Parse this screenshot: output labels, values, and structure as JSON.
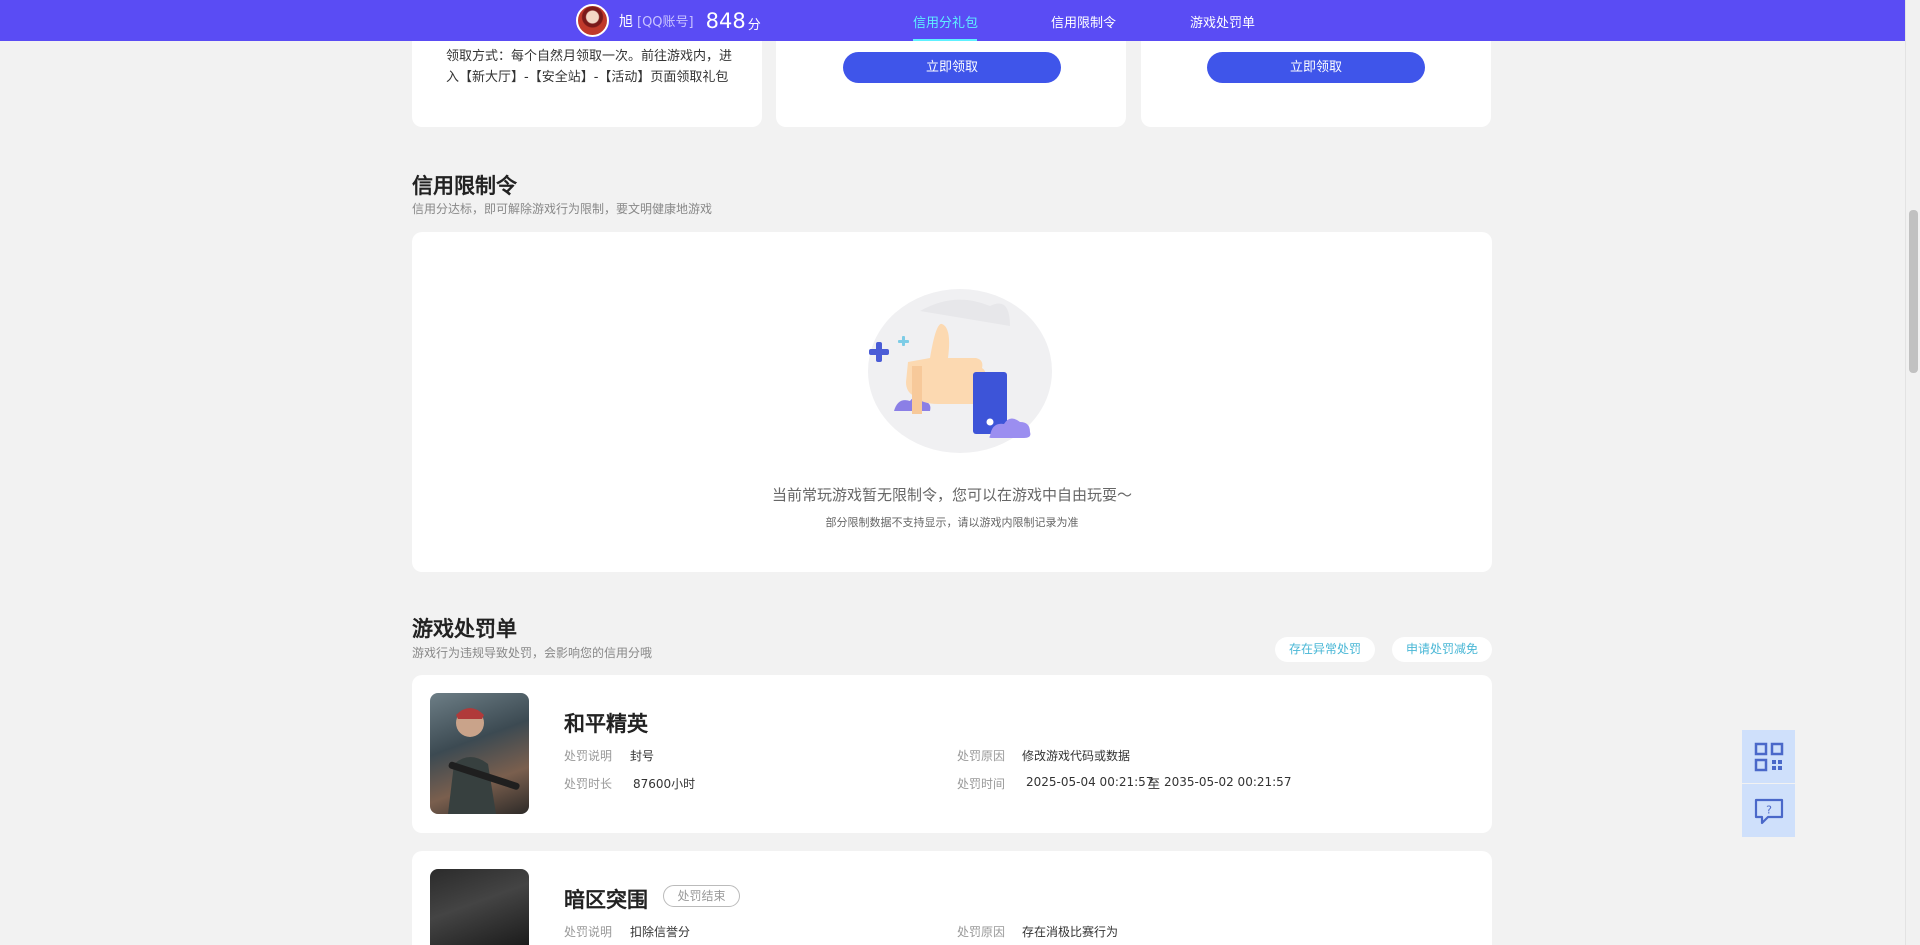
{
  "header": {
    "user_name": "旭",
    "account_type": "[QQ账号]",
    "score": "848",
    "score_unit": "分",
    "nav": [
      "信用分礼包",
      "信用限制令",
      "游戏处罚单"
    ]
  },
  "gift": {
    "claim_method": "领取方式：每个自然月领取一次。前往游戏内，进入【新大厅】-【安全站】-【活动】页面领取礼包",
    "claim_button_1": "立即领取",
    "claim_button_2": "立即领取"
  },
  "restriction": {
    "title": "信用限制令",
    "subtitle": "信用分达标，即可解除游戏行为限制，要文明健康地游戏",
    "empty_main": "当前常玩游戏暂无限制令，您可以在游戏中自由玩耍～",
    "empty_sub": "部分限制数据不支持显示，请以游戏内限制记录为准"
  },
  "penalty": {
    "title": "游戏处罚单",
    "subtitle": "游戏行为违规导致处罚，会影响您的信用分哦",
    "btn_abnormal": "存在异常处罚",
    "btn_reduce": "申请处罚减免",
    "items": [
      {
        "game": "和平精英",
        "desc_label": "处罚说明",
        "desc": "封号",
        "duration_label": "处罚时长",
        "duration": "87600小时",
        "reason_label": "处罚原因",
        "reason": "修改游戏代码或数据",
        "time_label": "处罚时间",
        "time_start": "2025-05-04 00:21:57",
        "time_sep": "至",
        "time_end": "2035-05-02 00:21:57"
      },
      {
        "game": "暗区突围",
        "status": "处罚结束",
        "desc_label": "处罚说明",
        "desc": "扣除信誉分",
        "reason_label": "处罚原因",
        "reason": "存在消极比赛行为"
      }
    ]
  },
  "icons": {
    "qr": "qr-code-icon",
    "help": "help-chat-icon"
  },
  "colors": {
    "nav_bg": "#5a4cf4",
    "nav_active": "#5ef1ff",
    "primary": "#3f55ea",
    "pill_text": "#49b7d6"
  }
}
